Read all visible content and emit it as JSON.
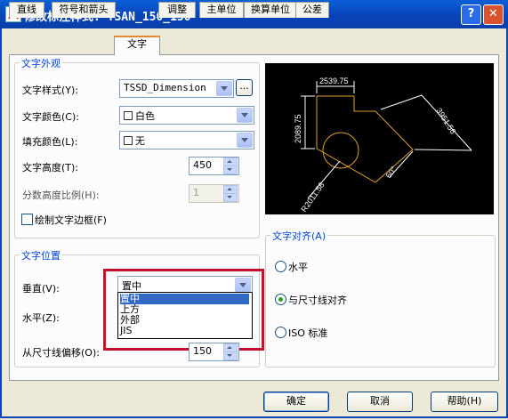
{
  "window": {
    "title": "修改标注样式: TSAN_150_150",
    "help_btn": "?",
    "close_btn": "✕"
  },
  "tabs": [
    "直线",
    "符号和箭头",
    "文字",
    "调整",
    "主单位",
    "换算单位",
    "公差"
  ],
  "text_appearance": {
    "title": "文字外观",
    "style_label": "文字样式(Y):",
    "style_value": "TSSD_Dimension",
    "style_btn": "...",
    "color_label": "文字颜色(C):",
    "color_value": "白色",
    "fill_label": "填充颜色(L):",
    "fill_value": "无",
    "height_label": "文字高度(T):",
    "height_value": "450",
    "fraction_label": "分数高度比例(H):",
    "fraction_value": "1",
    "frame_label": "绘制文字边框(F)"
  },
  "text_position": {
    "title": "文字位置",
    "vertical_label": "垂直(V):",
    "vertical_value": "置中",
    "horizontal_label": "水平(Z):",
    "offset_label": "从尺寸线偏移(O):",
    "offset_value": "150",
    "vertical_options": [
      "置中",
      "上方",
      "外部",
      "JIS"
    ]
  },
  "text_align": {
    "title": "文字对齐(A)",
    "options": [
      "水平",
      "与尺寸线对齐",
      "ISO 标准"
    ],
    "selected_index": 1
  },
  "preview": {
    "dims": [
      "2539.75",
      "2089.75",
      "3951.56",
      "R2011.58",
      "60°"
    ]
  },
  "buttons": {
    "ok": "确定",
    "cancel": "取消",
    "help": "帮助(H)"
  },
  "colors": {
    "accent": "#0046d5",
    "highlight": "#c8102e",
    "preview_bg": "#000000",
    "preview_line": "#e0a030"
  }
}
